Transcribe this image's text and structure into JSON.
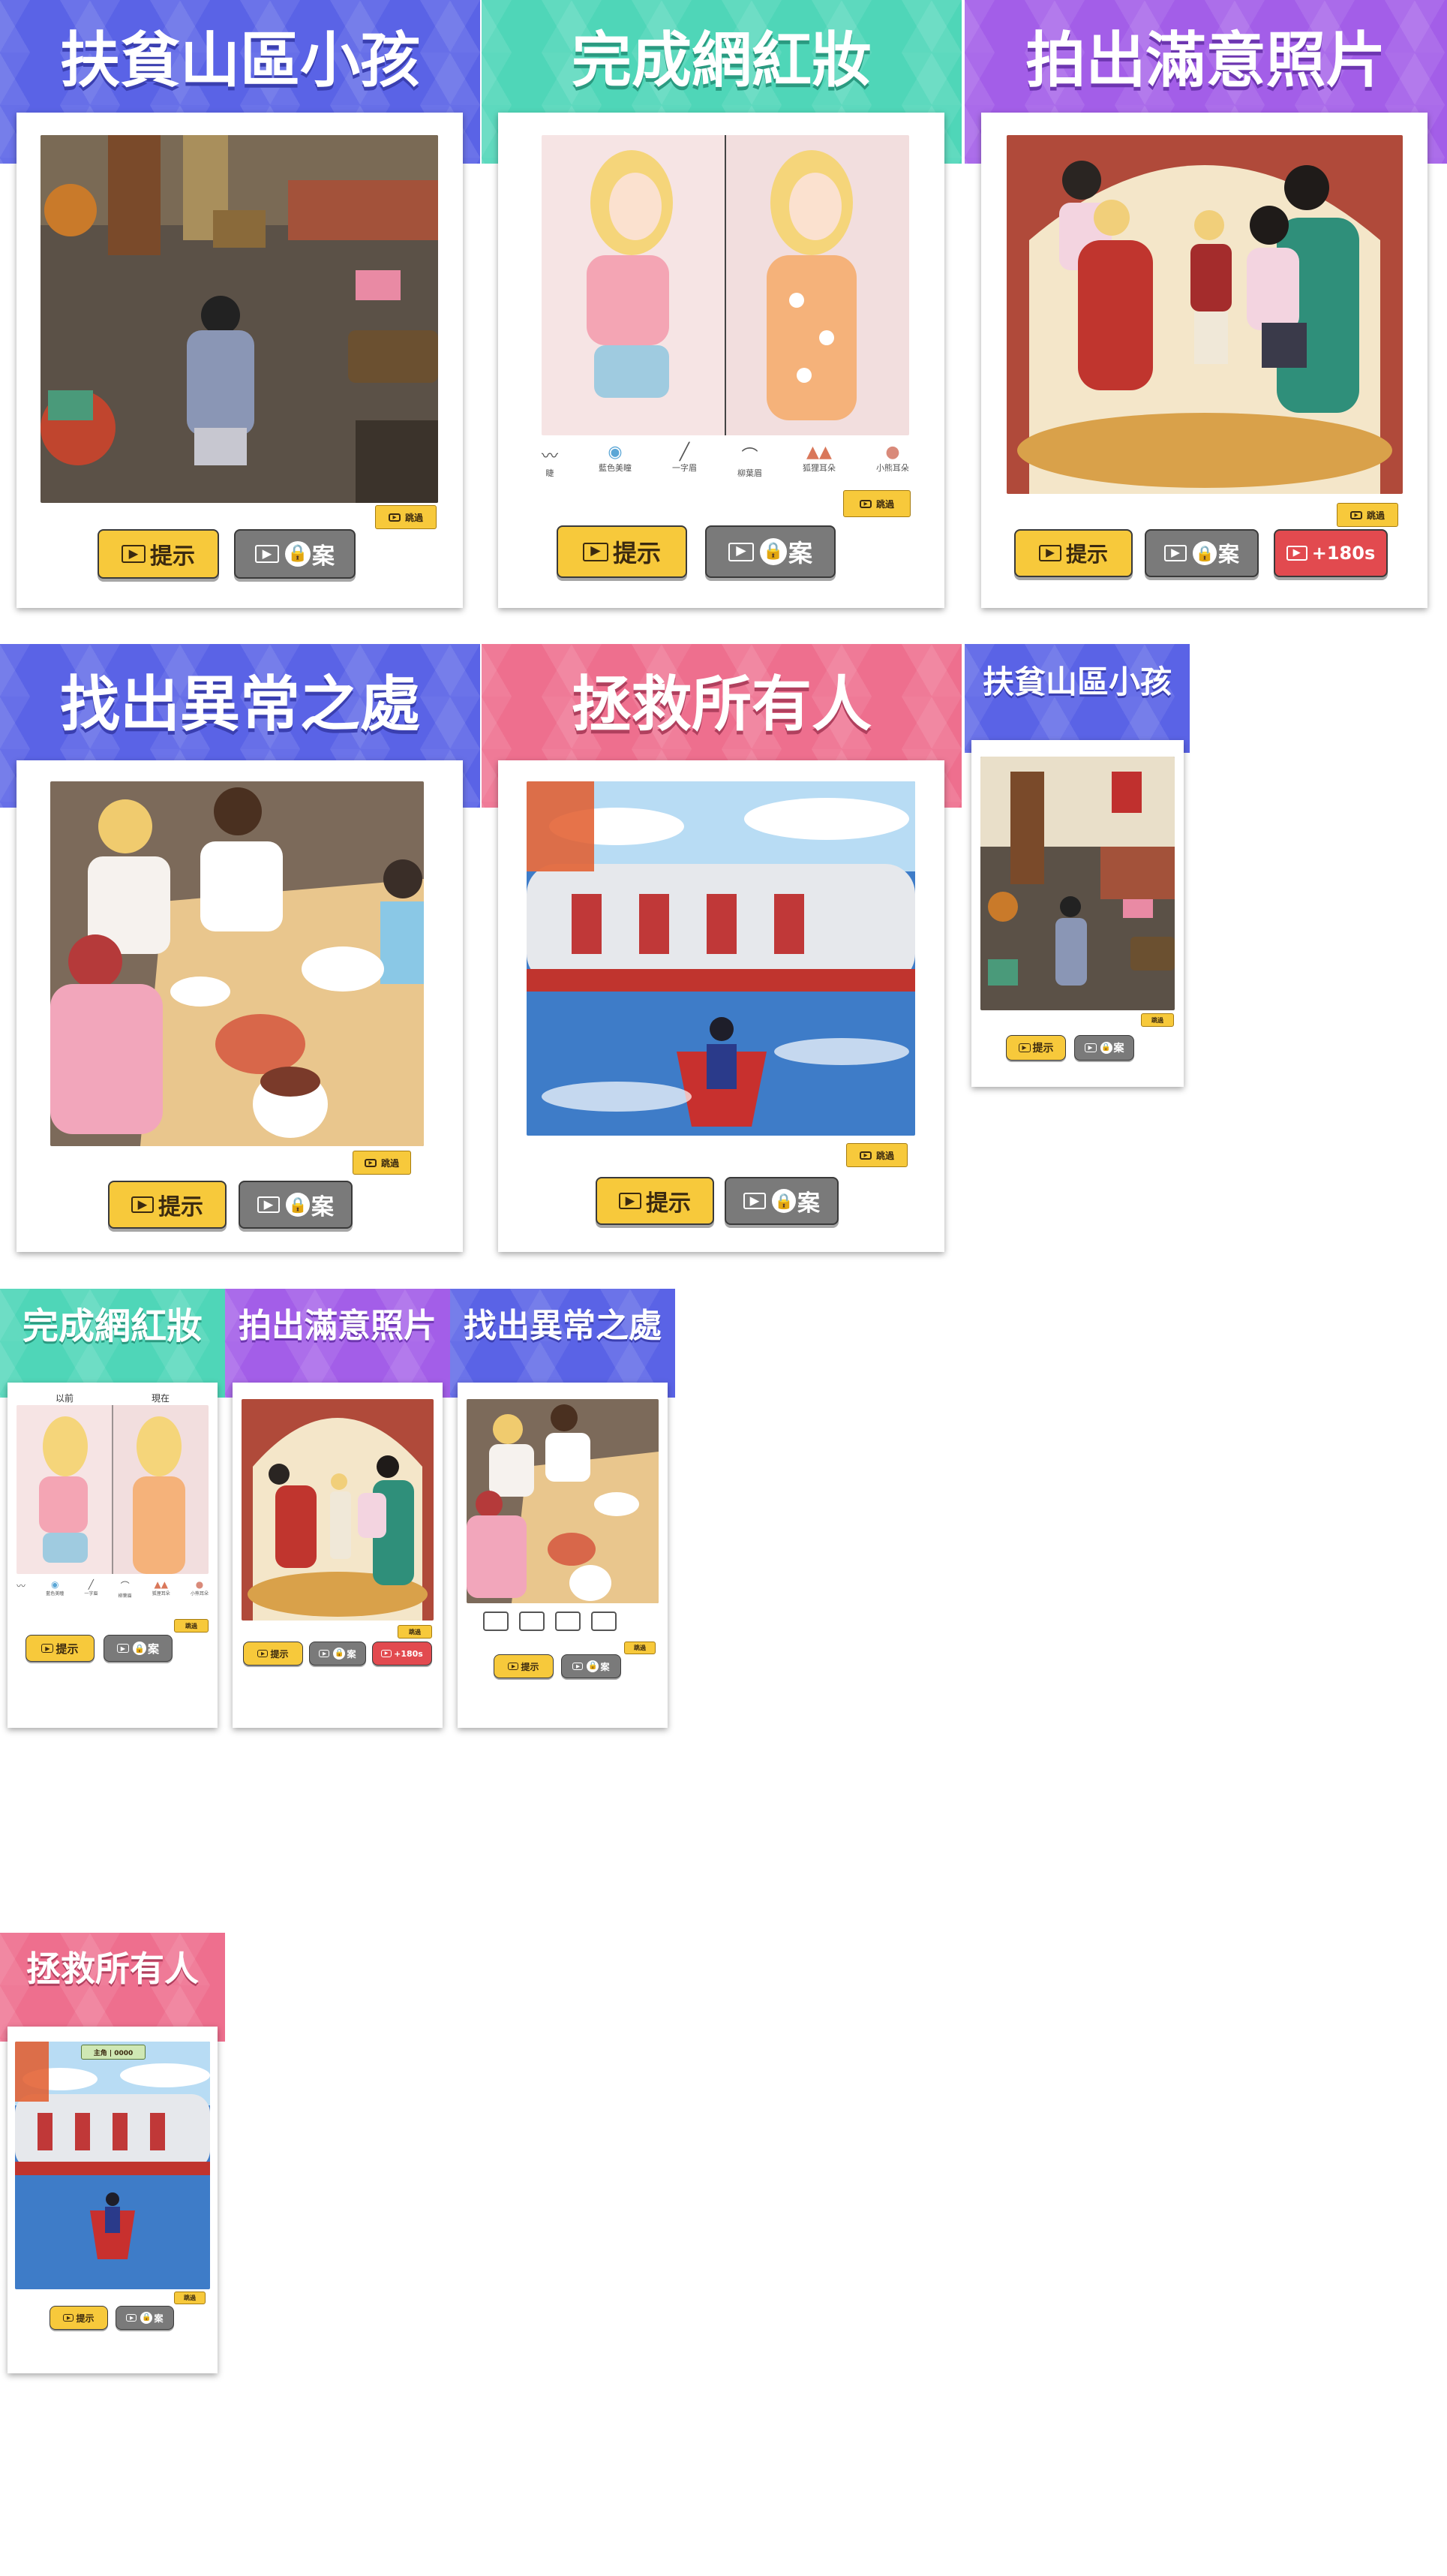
{
  "colors": {
    "blue_banner": "#5a63e6",
    "teal_banner": "#4fd6b8",
    "purple_banner": "#a35ee8",
    "pink_banner": "#ee6f8e",
    "hint_button": "#f7c93b",
    "answer_button": "#7a7a7a",
    "time_button": "#e24a4f"
  },
  "titles": {
    "poverty_child": "扶貧山區小孩",
    "makeup": "完成網紅妝",
    "photo": "拍出滿意照片",
    "anomaly": "找出異常之處",
    "rescue": "拯救所有人"
  },
  "buttons": {
    "hint_label": "提示",
    "answer_label": "案",
    "time_label": "+180s",
    "skip_tag": "跳過"
  },
  "icons": {
    "video": "video-play-icon",
    "lock": "lock-icon"
  },
  "makeup_items": [
    "睫",
    "藍色美瞳",
    "一字眉",
    "柳葉眉",
    "狐狸耳朵",
    "小熊耳朵"
  ],
  "makeup_small_items": [
    "",
    "藍色美瞳",
    "一字眉",
    "柳葉眉",
    "狐狸耳朵",
    "小熊耳朵"
  ],
  "makeup_compare": {
    "before": "以前",
    "after": "現在"
  },
  "rescue_timer": "主角 | 0000"
}
